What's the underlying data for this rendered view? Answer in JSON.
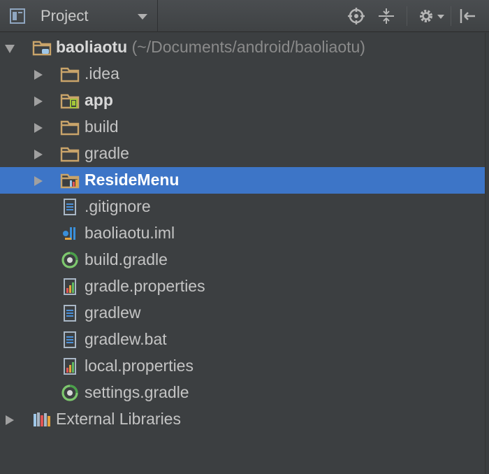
{
  "header": {
    "title": "Project",
    "icons": [
      "project-view-icon",
      "dropdown-arrow-icon",
      "locate-icon",
      "collapse-all-icon",
      "gear-icon",
      "hide-panel-icon"
    ]
  },
  "tree": {
    "root": {
      "name": "baoliaotu",
      "path": "(~/Documents/android/baoliaotu)"
    },
    "items": [
      {
        "label": ".idea",
        "icon": "folder-icon"
      },
      {
        "label": "app",
        "icon": "android-module-icon"
      },
      {
        "label": "build",
        "icon": "folder-icon"
      },
      {
        "label": "gradle",
        "icon": "folder-icon"
      },
      {
        "label": "ResideMenu",
        "icon": "library-module-icon"
      },
      {
        "label": ".gitignore",
        "icon": "text-file-icon"
      },
      {
        "label": "baoliaotu.iml",
        "icon": "iml-file-icon"
      },
      {
        "label": "build.gradle",
        "icon": "gradle-file-icon"
      },
      {
        "label": "gradle.properties",
        "icon": "properties-file-icon"
      },
      {
        "label": "gradlew",
        "icon": "text-file-icon"
      },
      {
        "label": "gradlew.bat",
        "icon": "text-file-icon"
      },
      {
        "label": "local.properties",
        "icon": "properties-file-icon"
      },
      {
        "label": "settings.gradle",
        "icon": "gradle-file-icon"
      }
    ],
    "external": {
      "label": "External Libraries",
      "icon": "external-libraries-icon"
    },
    "selected": "ResideMenu"
  },
  "colors": {
    "background": "#3c3f41",
    "selection": "#3d75c7",
    "folder": "#c9a46a",
    "gradle": "#7ec86e"
  }
}
